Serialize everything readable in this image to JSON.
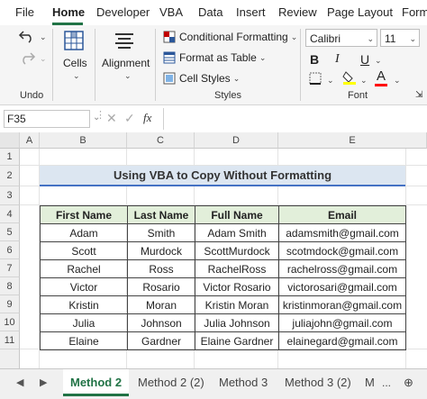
{
  "menu": {
    "items": [
      "File",
      "Home",
      "Developer",
      "VBA",
      "Data",
      "Insert",
      "Review",
      "Page Layout",
      "Form"
    ],
    "active": "Home"
  },
  "ribbon": {
    "undo_label": "Undo",
    "cells_label": "Cells",
    "alignment_label": "Alignment",
    "styles": {
      "conditional_formatting": "Conditional Formatting",
      "format_as_table": "Format as Table",
      "cell_styles": "Cell Styles",
      "group_label": "Styles"
    },
    "font": {
      "name": "Calibri",
      "size": "11",
      "group_label": "Font",
      "bold": "B",
      "italic": "I",
      "underline": "U",
      "highlight_color": "#ffff00",
      "font_color": "#ff0000"
    }
  },
  "formula_bar": {
    "name_box": "F35",
    "fx": "fx",
    "value": ""
  },
  "sheet": {
    "columns": [
      "A",
      "B",
      "C",
      "D",
      "E"
    ],
    "rows": [
      "1",
      "2",
      "3",
      "4",
      "5",
      "6",
      "7",
      "8",
      "9",
      "10",
      "11"
    ],
    "title": "Using VBA to Copy Without Formatting",
    "table": {
      "headers": [
        "First Name",
        "Last Name",
        "Full Name",
        "Email"
      ],
      "rows": [
        [
          "Adam",
          "Smith",
          "Adam Smith",
          "adamsmith@gmail.com"
        ],
        [
          "Scott",
          "Murdock",
          "ScottMurdock",
          "scotmdock@gmail.com"
        ],
        [
          "Rachel",
          "Ross",
          "RachelRoss",
          "rachelross@gmail.com"
        ],
        [
          "Victor",
          "Rosario",
          "Victor Rosario",
          "victorosari@gmail.com"
        ],
        [
          "Kristin",
          "Moran",
          "Kristin Moran",
          "kristinmoran@gmail.com"
        ],
        [
          "Julia",
          "Johnson",
          "Julia Johnson",
          "juliajohn@gmail.com"
        ],
        [
          "Elaine",
          "Gardner",
          "Elaine Gardner",
          "elainegard@gmail.com"
        ]
      ]
    }
  },
  "sheet_tabs": {
    "tabs": [
      "Method 2",
      "Method 2 (2)",
      "Method 3",
      "Method 3 (2)",
      "M"
    ],
    "active": "Method 2",
    "more": "..."
  },
  "colors": {
    "accent": "#217346",
    "title_fill": "#dce6f1",
    "header_fill": "#e2efda"
  }
}
